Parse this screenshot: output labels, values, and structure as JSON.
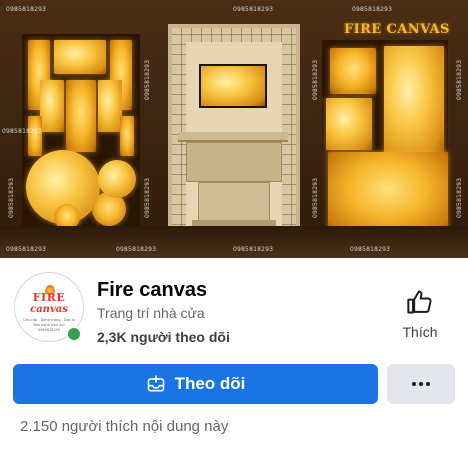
{
  "cover": {
    "phone_watermark": "0985818293",
    "brand_watermark": "FIRE CANVAS"
  },
  "avatar": {
    "logo_top": "FIRE",
    "logo_bottom": "canvas",
    "tagline": "Ceo cap - Dang trang - Doc la",
    "subline": "Bao hanh tron doi",
    "phone": "0985818293"
  },
  "page": {
    "name": "Fire canvas",
    "category": "Trang trí nhà cửa",
    "followers": "2,3K người theo dõi",
    "online": true
  },
  "actions": {
    "like_label": "Thích",
    "follow_label": "Theo dõi",
    "more_icon": "more-dots-icon"
  },
  "stats": {
    "likes_text": "2.150 người thích nội dung này"
  },
  "colors": {
    "primary": "#1b74e4",
    "secondary_bg": "#e4e6eb",
    "online": "#31a24c",
    "text_primary": "#050505",
    "text_secondary": "#65676b"
  }
}
